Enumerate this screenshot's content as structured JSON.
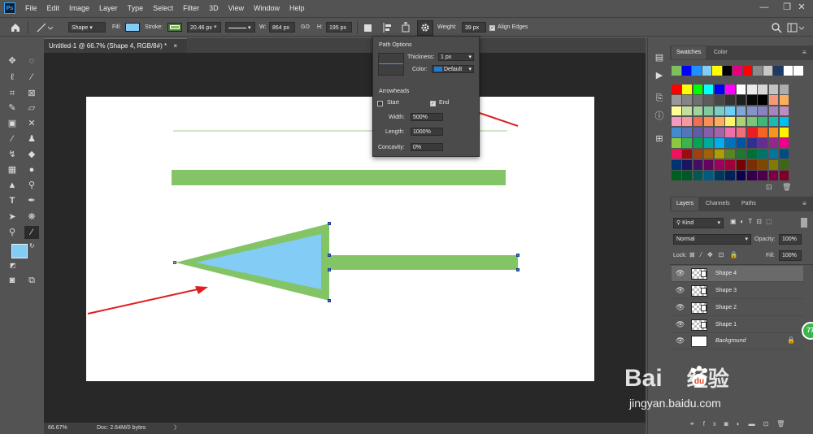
{
  "app": {
    "logo": "Ps"
  },
  "menu": [
    "File",
    "Edit",
    "Image",
    "Layer",
    "Type",
    "Select",
    "Filter",
    "3D",
    "View",
    "Window",
    "Help"
  ],
  "window_controls": {
    "minimize": "—",
    "restore": "❐",
    "close": "✕"
  },
  "options": {
    "mode": "Shape",
    "fill_label": "Fill:",
    "fill_color": "#83ccf5",
    "stroke_label": "Stroke:",
    "stroke_color": "#7fbf5f",
    "stroke_width": "20.46 px",
    "w_label": "W:",
    "w_value": "864 px",
    "link": "GO",
    "h_label": "H:",
    "h_value": "195 px",
    "weight_label": "Weight:",
    "weight_value": "39 px",
    "align_edges": "Align Edges"
  },
  "doc": {
    "tab": "Untitled-1 @ 66.7% (Shape 4, RGB/8#) *",
    "close": "×"
  },
  "status": {
    "zoom": "66.67%",
    "doc": "Doc: 2.64M/0 bytes",
    "arrow": "〉"
  },
  "path_options": {
    "title": "Path Options",
    "thickness_label": "Thickness:",
    "thickness_value": "1 px",
    "color_label": "Color:",
    "color_value": "Default",
    "color_swatch": "#1e7bd8",
    "arrowheads": "Arrowheads",
    "start": "Start",
    "end": "End",
    "width_label": "Width:",
    "width_value": "500%",
    "length_label": "Length:",
    "length_value": "1000%",
    "concavity_label": "Concavity:",
    "concavity_value": "0%"
  },
  "panels": {
    "swatches_tab": "Swatches",
    "color_tab": "Color",
    "layers_tab": "Layers",
    "channels_tab": "Channels",
    "paths_tab": "Paths",
    "kind": "Kind",
    "blend": "Normal",
    "opacity_label": "Opacity:",
    "opacity_value": "100%",
    "lock_label": "Lock:",
    "fill_label": "Fill:",
    "fill_value": "100%"
  },
  "layers": [
    {
      "name": "Shape 4",
      "selected": true
    },
    {
      "name": "Shape 3",
      "selected": false
    },
    {
      "name": "Shape 2",
      "selected": false
    },
    {
      "name": "Shape 1",
      "selected": false
    },
    {
      "name": "Background",
      "selected": false
    }
  ],
  "badge": "77",
  "watermark": {
    "logo": "Bai",
    "logo_cn": "经验",
    "url": "jingyan.baidu.com"
  },
  "swatches_top": [
    "#7fbf5f",
    "#0000ff",
    "#1e90ff",
    "#83ccf5",
    "#ffff00",
    "#000000",
    "#e6007e",
    "#ff0000",
    "#8a8a8a",
    "#c8c8c8",
    "#1f3864",
    "#ffffff",
    "#ffffff"
  ],
  "swatches": [
    "#ff0000",
    "#ffff00",
    "#00ff00",
    "#00ffff",
    "#0000ff",
    "#ff00ff",
    "#ffffff",
    "#ebebeb",
    "#d6d6d6",
    "#c2c2c2",
    "#adadad",
    "#999999",
    "#858585",
    "#707070",
    "#5c5c5c",
    "#474747",
    "#333333",
    "#1f1f1f",
    "#0a0a0a",
    "#000000",
    "#f7977a",
    "#fbaf5d",
    "#ffff99",
    "#c4df9b",
    "#a2d39c",
    "#82ca9d",
    "#7bcdc8",
    "#6ecff6",
    "#7ea7d8",
    "#8493ca",
    "#8882be",
    "#a187be",
    "#bc8dbf",
    "#f49ac2",
    "#f6989d",
    "#f26c4f",
    "#f68e55",
    "#fbaf5c",
    "#fff467",
    "#acd372",
    "#7cc576",
    "#3bb878",
    "#1abbb4",
    "#00bff3",
    "#438ccb",
    "#5574b9",
    "#605ca8",
    "#855fa8",
    "#a763a8",
    "#f06ea9",
    "#f26d7d",
    "#ed1c24",
    "#f26522",
    "#f7941d",
    "#fff200",
    "#8dc73f",
    "#39b54a",
    "#00a651",
    "#00a99d",
    "#00aeef",
    "#0072bc",
    "#0054a6",
    "#2e3192",
    "#662d91",
    "#92278f",
    "#ec008c",
    "#ed145b",
    "#9e0b0f",
    "#a0410d",
    "#a3620a",
    "#aba000",
    "#598527",
    "#1a7b30",
    "#007236",
    "#00746b",
    "#0076a3",
    "#004b80",
    "#003471",
    "#1b1464",
    "#440e62",
    "#630460",
    "#9e005d",
    "#9e0039",
    "#790000",
    "#7b2e00",
    "#7d4900",
    "#827b00",
    "#406618",
    "#005e20",
    "#005826",
    "#005952",
    "#005b7f",
    "#003663",
    "#002157",
    "#0d004c",
    "#32004b",
    "#4b0049",
    "#7b0046",
    "#7a0026"
  ]
}
